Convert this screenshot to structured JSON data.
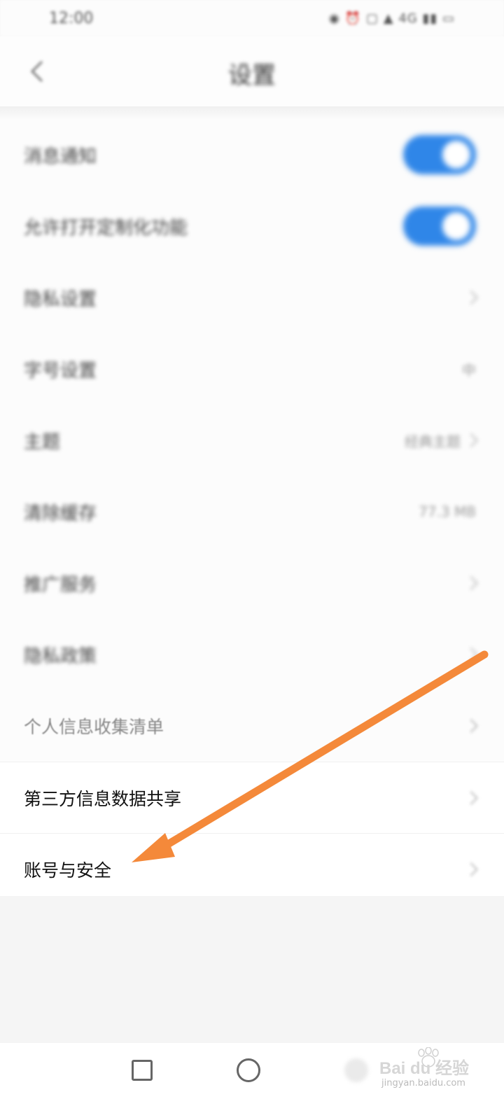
{
  "status_bar": {
    "time": "12:00",
    "icons": "◉ ⏰ ▢ ▲ 4G ▮▮ ▭"
  },
  "header": {
    "title": "设置",
    "back_icon": "back-chevron-icon"
  },
  "settings": {
    "rows": [
      {
        "label": "消息通知",
        "type": "toggle",
        "on": true
      },
      {
        "label": "允许打开定制化功能",
        "type": "toggle",
        "on": true
      },
      {
        "label": "隐私设置",
        "type": "link"
      },
      {
        "label": "字号设置",
        "type": "value",
        "value": "中"
      },
      {
        "label": "主题",
        "type": "value",
        "value": "经典主题"
      },
      {
        "label": "清除缓存",
        "type": "value",
        "value": "77.3 MB"
      },
      {
        "label": "推广服务",
        "type": "link"
      },
      {
        "label": "隐私政策",
        "type": "link"
      },
      {
        "label": "个人信息收集清单",
        "type": "link"
      },
      {
        "label": "第三方信息数据共享",
        "type": "link"
      },
      {
        "label": "账号与安全",
        "type": "link"
      }
    ]
  },
  "annotation": {
    "color": "#f4893a"
  },
  "nav": {
    "recent_icon": "square-recent-icon",
    "home_icon": "circle-home-icon",
    "back_icon": "back-nav-icon"
  },
  "watermark": {
    "brand": "Bai du 经验",
    "url": "jingyan.baidu.com"
  },
  "colors": {
    "toggle_on": "#2f86e8",
    "arrow": "#f4893a"
  }
}
